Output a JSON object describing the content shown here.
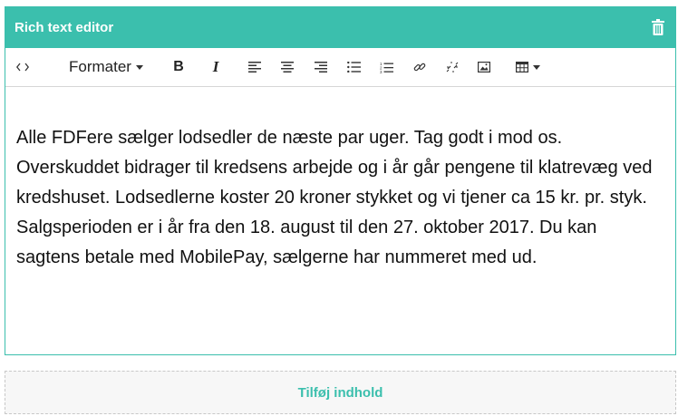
{
  "editor": {
    "title": "Rich text editor",
    "delete_icon": "trash-icon",
    "accent_color": "#3bbfad"
  },
  "toolbar": {
    "source_icon": "code-icon",
    "format_label": "Formater",
    "bold_label": "B",
    "italic_label": "I",
    "align_left_icon": "align-left-icon",
    "align_center_icon": "align-center-icon",
    "align_right_icon": "align-right-icon",
    "bullet_list_icon": "bullet-list-icon",
    "numbered_list_icon": "numbered-list-icon",
    "link_icon": "link-icon",
    "unlink_icon": "unlink-icon",
    "image_icon": "image-icon",
    "table_icon": "table-icon"
  },
  "content": {
    "text": "Alle FDFere sælger lodsedler de næste par uger. Tag godt i mod os. Overskuddet bidrager til kredsens arbejde og i år går pengene til klatrevæg ved kredshuset. Lodsedlerne koster 20 kroner stykket og vi tjener ca 15 kr. pr. styk. Salgsperioden er i år fra den 18. august til den 27. oktober 2017. Du kan sagtens betale med MobilePay, sælgerne har nummeret med ud."
  },
  "add_content": {
    "label": "Tilføj indhold"
  }
}
